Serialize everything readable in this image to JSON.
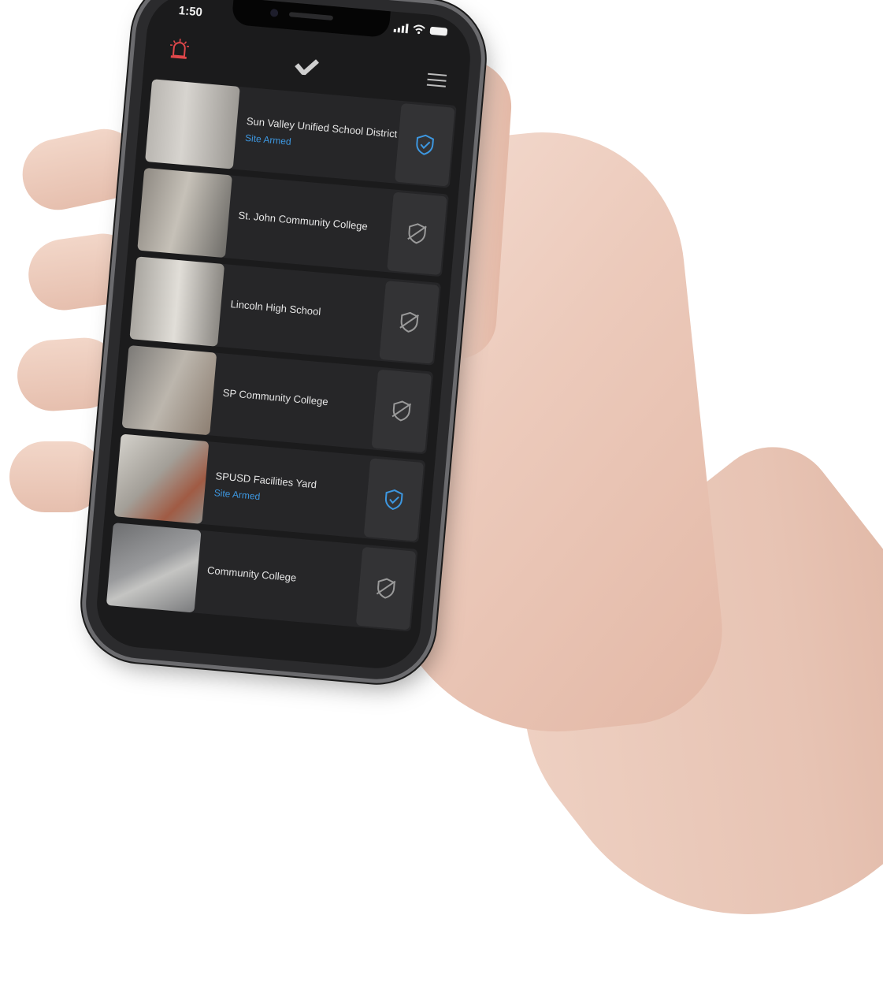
{
  "status_bar": {
    "time": "1:50"
  },
  "app_bar": {
    "alarm_icon": "alarm-siren-icon",
    "logo_icon": "brand-check-logo-icon",
    "menu_icon": "hamburger-menu-icon"
  },
  "colors": {
    "armed_blue": "#3d97e0",
    "alarm_red": "#e0474a",
    "disarmed_gray": "#9a9a9a"
  },
  "sites": [
    {
      "name": "Sun Valley Unified School District",
      "status": "Site Armed",
      "armed": true
    },
    {
      "name": "St. John Community College",
      "status": "",
      "armed": false
    },
    {
      "name": "Lincoln High School",
      "status": "",
      "armed": false
    },
    {
      "name": "SP Community College",
      "status": "",
      "armed": false
    },
    {
      "name": "SPUSD Facilities Yard",
      "status": "Site Armed",
      "armed": true
    },
    {
      "name": "Community College",
      "status": "",
      "armed": false
    }
  ]
}
